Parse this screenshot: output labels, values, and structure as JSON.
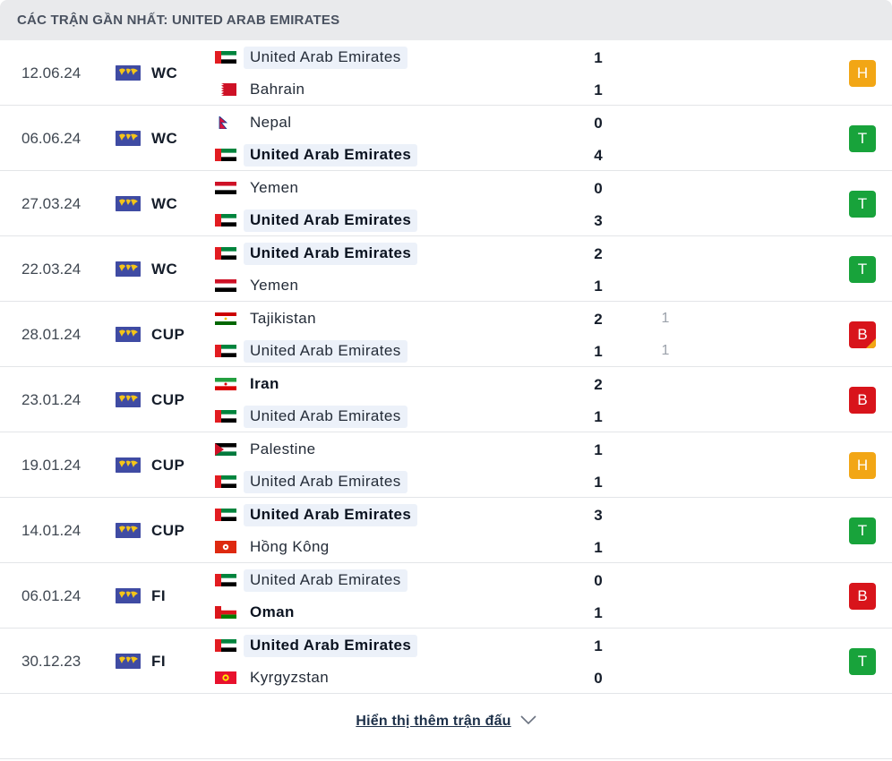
{
  "header": {
    "title": "CÁC TRẬN GẦN NHẤT: UNITED ARAB EMIRATES"
  },
  "colors": {
    "win": "#18a33b",
    "draw": "#f2a615",
    "loss": "#d8141b",
    "highlight": "#ecf1f9"
  },
  "matches": [
    {
      "date": "12.06.24",
      "comp": "WC",
      "comp_icon": "world-icon",
      "home": {
        "name": "United Arab Emirates",
        "flag": "uae",
        "bold": false,
        "highlight": true
      },
      "away": {
        "name": "Bahrain",
        "flag": "bahrain",
        "bold": false,
        "highlight": false
      },
      "home_score": "1",
      "away_score": "1",
      "home_pen": "",
      "away_pen": "",
      "result": "H",
      "result_type": "draw",
      "pen_marker": false
    },
    {
      "date": "06.06.24",
      "comp": "WC",
      "comp_icon": "world-icon",
      "home": {
        "name": "Nepal",
        "flag": "nepal",
        "bold": false,
        "highlight": false
      },
      "away": {
        "name": "United Arab Emirates",
        "flag": "uae",
        "bold": true,
        "highlight": true
      },
      "home_score": "0",
      "away_score": "4",
      "home_pen": "",
      "away_pen": "",
      "result": "T",
      "result_type": "win",
      "pen_marker": false
    },
    {
      "date": "27.03.24",
      "comp": "WC",
      "comp_icon": "world-icon",
      "home": {
        "name": "Yemen",
        "flag": "yemen",
        "bold": false,
        "highlight": false
      },
      "away": {
        "name": "United Arab Emirates",
        "flag": "uae",
        "bold": true,
        "highlight": true
      },
      "home_score": "0",
      "away_score": "3",
      "home_pen": "",
      "away_pen": "",
      "result": "T",
      "result_type": "win",
      "pen_marker": false
    },
    {
      "date": "22.03.24",
      "comp": "WC",
      "comp_icon": "world-icon",
      "home": {
        "name": "United Arab Emirates",
        "flag": "uae",
        "bold": true,
        "highlight": true
      },
      "away": {
        "name": "Yemen",
        "flag": "yemen",
        "bold": false,
        "highlight": false
      },
      "home_score": "2",
      "away_score": "1",
      "home_pen": "",
      "away_pen": "",
      "result": "T",
      "result_type": "win",
      "pen_marker": false
    },
    {
      "date": "28.01.24",
      "comp": "CUP",
      "comp_icon": "world-icon",
      "home": {
        "name": "Tajikistan",
        "flag": "tajikistan",
        "bold": false,
        "highlight": false
      },
      "away": {
        "name": "United Arab Emirates",
        "flag": "uae",
        "bold": false,
        "highlight": true
      },
      "home_score": "2",
      "away_score": "1",
      "home_pen": "1",
      "away_pen": "1",
      "result": "B",
      "result_type": "loss",
      "pen_marker": true
    },
    {
      "date": "23.01.24",
      "comp": "CUP",
      "comp_icon": "world-icon",
      "home": {
        "name": "Iran",
        "flag": "iran",
        "bold": true,
        "highlight": false
      },
      "away": {
        "name": "United Arab Emirates",
        "flag": "uae",
        "bold": false,
        "highlight": true
      },
      "home_score": "2",
      "away_score": "1",
      "home_pen": "",
      "away_pen": "",
      "result": "B",
      "result_type": "loss",
      "pen_marker": false
    },
    {
      "date": "19.01.24",
      "comp": "CUP",
      "comp_icon": "world-icon",
      "home": {
        "name": "Palestine",
        "flag": "palestine",
        "bold": false,
        "highlight": false
      },
      "away": {
        "name": "United Arab Emirates",
        "flag": "uae",
        "bold": false,
        "highlight": true
      },
      "home_score": "1",
      "away_score": "1",
      "home_pen": "",
      "away_pen": "",
      "result": "H",
      "result_type": "draw",
      "pen_marker": false
    },
    {
      "date": "14.01.24",
      "comp": "CUP",
      "comp_icon": "world-icon",
      "home": {
        "name": "United Arab Emirates",
        "flag": "uae",
        "bold": true,
        "highlight": true
      },
      "away": {
        "name": "Hồng Kông",
        "flag": "hongkong",
        "bold": false,
        "highlight": false
      },
      "home_score": "3",
      "away_score": "1",
      "home_pen": "",
      "away_pen": "",
      "result": "T",
      "result_type": "win",
      "pen_marker": false
    },
    {
      "date": "06.01.24",
      "comp": "FI",
      "comp_icon": "world-icon",
      "home": {
        "name": "United Arab Emirates",
        "flag": "uae",
        "bold": false,
        "highlight": true
      },
      "away": {
        "name": "Oman",
        "flag": "oman",
        "bold": true,
        "highlight": false
      },
      "home_score": "0",
      "away_score": "1",
      "home_pen": "",
      "away_pen": "",
      "result": "B",
      "result_type": "loss",
      "pen_marker": false
    },
    {
      "date": "30.12.23",
      "comp": "FI",
      "comp_icon": "world-icon",
      "home": {
        "name": "United Arab Emirates",
        "flag": "uae",
        "bold": true,
        "highlight": true
      },
      "away": {
        "name": "Kyrgyzstan",
        "flag": "kyrgyzstan",
        "bold": false,
        "highlight": false
      },
      "home_score": "1",
      "away_score": "0",
      "home_pen": "",
      "away_pen": "",
      "result": "T",
      "result_type": "win",
      "pen_marker": false
    }
  ],
  "footer": {
    "show_more_label": "Hiển thị thêm trận đấu",
    "show_more_icon": "chevron-down-icon"
  }
}
